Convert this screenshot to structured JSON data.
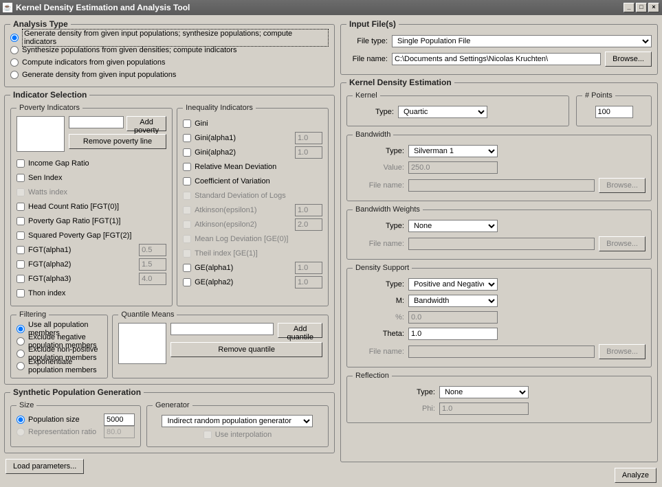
{
  "window": {
    "title": "Kernel Density Estimation and Analysis Tool"
  },
  "analysisType": {
    "legend": "Analysis Type",
    "options": [
      "Generate density from given input populations; synthesize populations; compute indicators",
      "Synthesize populations from given densities; compute indicators",
      "Compute indicators from given populations",
      "Generate density from given input populations"
    ]
  },
  "indicatorSelection": {
    "legend": "Indicator Selection",
    "poverty": {
      "legend": "Poverty Indicators",
      "addBtn": "Add poverty line",
      "removeBtn": "Remove poverty line",
      "items": [
        {
          "label": "Income Gap Ratio",
          "disabled": false
        },
        {
          "label": "Sen Index",
          "disabled": false
        },
        {
          "label": "Watts index",
          "disabled": true
        },
        {
          "label": "Head Count Ratio [FGT(0)]",
          "disabled": false
        },
        {
          "label": "Poverty Gap Ratio [FGT(1)]",
          "disabled": false
        },
        {
          "label": "Squared Poverty Gap [FGT(2)]",
          "disabled": false
        },
        {
          "label": "FGT(alpha1)",
          "disabled": false,
          "val": "0.5"
        },
        {
          "label": "FGT(alpha2)",
          "disabled": false,
          "val": "1.5"
        },
        {
          "label": "FGT(alpha3)",
          "disabled": false,
          "val": "4.0"
        },
        {
          "label": "Thon index",
          "disabled": false
        }
      ]
    },
    "inequality": {
      "legend": "Inequality Indicators",
      "items": [
        {
          "label": "Gini",
          "disabled": false
        },
        {
          "label": "Gini(alpha1)",
          "disabled": false,
          "val": "1.0"
        },
        {
          "label": "Gini(alpha2)",
          "disabled": false,
          "val": "1.0"
        },
        {
          "label": "Relative Mean Deviation",
          "disabled": false
        },
        {
          "label": "Coefficient of Variation",
          "disabled": false
        },
        {
          "label": "Standard Deviation of Logs",
          "disabled": true
        },
        {
          "label": "Atkinson(epsilon1)",
          "disabled": true,
          "val": "1.0"
        },
        {
          "label": "Atkinson(epsilon2)",
          "disabled": true,
          "val": "2.0"
        },
        {
          "label": "Mean Log Deviation [GE(0)]",
          "disabled": true
        },
        {
          "label": "Theil index [GE(1)]",
          "disabled": true
        },
        {
          "label": "GE(alpha1)",
          "disabled": false,
          "val": "1.0"
        },
        {
          "label": "GE(alpha2)",
          "disabled": false,
          "val": "1.0"
        }
      ]
    }
  },
  "filtering": {
    "legend": "Filtering",
    "options": [
      "Use all population members",
      "Exclude negative population members",
      "Exclude non-positive population members",
      "Exponentiate population members"
    ]
  },
  "quantile": {
    "legend": "Quantile Means",
    "addBtn": "Add quantile",
    "removeBtn": "Remove quantile"
  },
  "synthetic": {
    "legend": "Synthetic Population Generation",
    "size": {
      "legend": "Size",
      "popSize": "Population size",
      "popSizeVal": "5000",
      "repRatio": "Representation ratio",
      "repRatioVal": "80.0"
    },
    "generator": {
      "legend": "Generator",
      "value": "Indirect random population generator",
      "useInterp": "Use interpolation"
    }
  },
  "inputFiles": {
    "legend": "Input File(s)",
    "fileType": "File type:",
    "fileTypeVal": "Single Population File",
    "fileName": "File name:",
    "fileNameVal": "C:\\Documents and Settings\\Nicolas Kruchten\\",
    "browse": "Browse..."
  },
  "kde": {
    "legend": "Kernel Density Estimation",
    "kernel": {
      "legend": "Kernel",
      "type": "Type:",
      "typeVal": "Quartic"
    },
    "points": {
      "legend": "# Points",
      "val": "100"
    },
    "bandwidth": {
      "legend": "Bandwidth",
      "type": "Type:",
      "typeVal": "Silverman 1",
      "value": "Value:",
      "valueVal": "250.0",
      "fileName": "File name:",
      "browse": "Browse..."
    },
    "bwWeights": {
      "legend": "Bandwidth Weights",
      "type": "Type:",
      "typeVal": "None",
      "fileName": "File name:",
      "browse": "Browse..."
    },
    "support": {
      "legend": "Density Support",
      "type": "Type:",
      "typeVal": "Positive and Negative",
      "m": "M:",
      "mVal": "Bandwidth",
      "pct": "%:",
      "pctVal": "0.0",
      "theta": "Theta:",
      "thetaVal": "1.0",
      "fileName": "File name:",
      "browse": "Browse..."
    },
    "reflection": {
      "legend": "Reflection",
      "type": "Type:",
      "typeVal": "None",
      "phi": "Phi:",
      "phiVal": "1.0"
    }
  },
  "buttons": {
    "load": "Load parameters...",
    "analyze": "Analyze"
  }
}
